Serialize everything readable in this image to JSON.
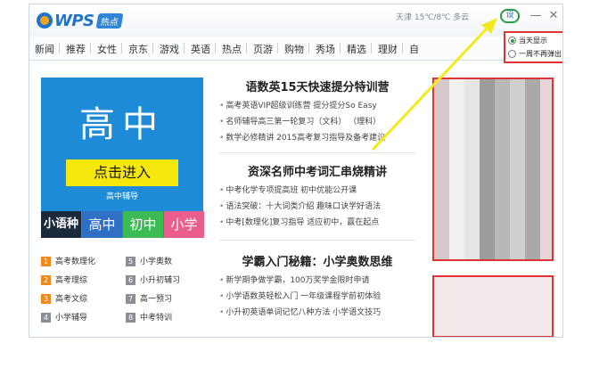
{
  "app": {
    "brand": "WPS",
    "badge": "热点",
    "weather": "天津 15℃/8℃ 多云",
    "settings_label": "设",
    "min_label": "—",
    "close_label": "✕"
  },
  "nav": [
    "新闻",
    "推荐",
    "女性",
    "京东",
    "游戏",
    "英语",
    "热点",
    "页游",
    "购物",
    "秀场",
    "精选",
    "理财",
    "自"
  ],
  "banner": {
    "title": "高中",
    "button": "点击进入",
    "caption": "高中辅导",
    "levels": [
      "小语种",
      "高中",
      "初中",
      "小学"
    ]
  },
  "links": [
    {
      "num": "1",
      "label": "高考数理化",
      "style": "orange"
    },
    {
      "num": "5",
      "label": "小学奥数",
      "style": "gray"
    },
    {
      "num": "2",
      "label": "高考理综",
      "style": "orange"
    },
    {
      "num": "6",
      "label": "小升初辅习",
      "style": "gray"
    },
    {
      "num": "3",
      "label": "高考文综",
      "style": "orange"
    },
    {
      "num": "7",
      "label": "高一预习",
      "style": "gray"
    },
    {
      "num": "4",
      "label": "小学辅导",
      "style": "gray"
    },
    {
      "num": "8",
      "label": "中考特训",
      "style": "gray"
    }
  ],
  "sections": [
    {
      "title": "语数英15天快速提分特训营",
      "items": [
        "高考英语VIP超级训练营  提分提分So Easy",
        "名师辅导高三第一轮复习（文科）  （理科）",
        "数学必修精讲  2015高考复习指导及备考建议"
      ]
    },
    {
      "title": "资深名师中考词汇串烧精讲",
      "items": [
        "中考化学专项提高班  初中优能公开课",
        "语法突破：十大词类介绍  趣味口诀学好语法",
        "中考[数理化]复习指导    适应初中，赢在起点"
      ]
    },
    {
      "title": "学霸入门秘籍：小学奥数思维",
      "items": [
        "新学期争做学霸，100万奖学金限时申请",
        "小学语数英轻松入门  一年级课程学前初体验",
        "小升初英语单词记忆八种方法  小学语文技巧"
      ]
    }
  ],
  "popup": {
    "options": [
      {
        "label": "当天显示",
        "selected": true
      },
      {
        "label": "一周不再弹出",
        "selected": false
      }
    ]
  },
  "colors": {
    "highlight": "#e03434",
    "arrow": "#f2ea1e",
    "settings_ring": "#2b9b45"
  }
}
